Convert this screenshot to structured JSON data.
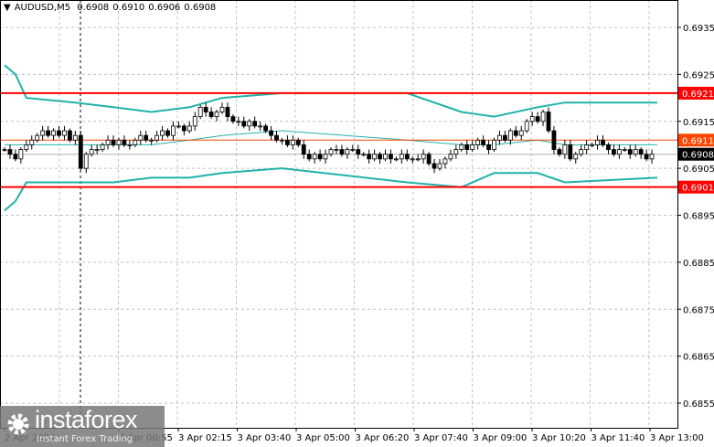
{
  "header": {
    "symbol": "AUDUSD,M5",
    "ohlc": [
      "0.6908",
      "0.6910",
      "0.6906",
      "0.6908"
    ]
  },
  "logo": {
    "brand": "instaforex",
    "tagline": "Instant Forex Trading"
  },
  "colors": {
    "candle": "#000000",
    "bands": "#20b2aa",
    "level": "#ff0000",
    "last_level": "#ff4500",
    "bid": "#000000",
    "grid": "#c0c0c0"
  },
  "chart_data": {
    "type": "candlestick",
    "title": "AUDUSD,M5",
    "ylim": [
      0.6851,
      0.6941
    ],
    "y_ticks": [
      "0.6935",
      "0.6925",
      "0.6915",
      "0.6905",
      "0.6895",
      "0.6885",
      "0.6875",
      "0.6865",
      "0.6855"
    ],
    "x_ticks": [
      "2 Apr 2026",
      "3 Apr 00:55",
      "3 Apr 02:15",
      "3 Apr 03:40",
      "3 Apr 05:00",
      "3 Apr 06:20",
      "3 Apr 07:40",
      "3 Apr 09:00",
      "3 Apr 10:20",
      "3 Apr 11:40",
      "3 Apr 13:00"
    ],
    "grid": true,
    "closes": [
      0.6909,
      0.6908,
      0.6907,
      0.6909,
      0.691,
      0.6911,
      0.6912,
      0.6913,
      0.6912,
      0.6913,
      0.6912,
      0.6913,
      0.6911,
      0.6912,
      0.6905,
      0.6908,
      0.6909,
      0.6909,
      0.691,
      0.6911,
      0.691,
      0.6911,
      0.691,
      0.691,
      0.6911,
      0.6912,
      0.6911,
      0.6911,
      0.6912,
      0.6913,
      0.6912,
      0.6914,
      0.6914,
      0.6913,
      0.6914,
      0.6916,
      0.6918,
      0.6917,
      0.6916,
      0.6917,
      0.6918,
      0.6916,
      0.6915,
      0.6915,
      0.6914,
      0.6915,
      0.6914,
      0.6914,
      0.6913,
      0.6912,
      0.6911,
      0.6911,
      0.691,
      0.6911,
      0.691,
      0.6908,
      0.6907,
      0.6908,
      0.6907,
      0.6908,
      0.6909,
      0.6909,
      0.6908,
      0.6909,
      0.6909,
      0.6908,
      0.6908,
      0.6907,
      0.6908,
      0.6907,
      0.6908,
      0.6907,
      0.6907,
      0.6908,
      0.6907,
      0.6907,
      0.6907,
      0.6908,
      0.6906,
      0.6905,
      0.6906,
      0.6907,
      0.6908,
      0.6909,
      0.691,
      0.6909,
      0.691,
      0.6911,
      0.691,
      0.6909,
      0.6911,
      0.6912,
      0.6911,
      0.6913,
      0.6912,
      0.6913,
      0.6915,
      0.6916,
      0.6915,
      0.6917,
      0.6913,
      0.6909,
      0.6908,
      0.691,
      0.6907,
      0.6908,
      0.6909,
      0.691,
      0.691,
      0.6911,
      0.691,
      0.6909,
      0.6908,
      0.6909,
      0.6909,
      0.6908,
      0.6909,
      0.6908,
      0.6907,
      0.6908
    ],
    "bollinger": {
      "bar_index": [
        0,
        2,
        4,
        13,
        20,
        27,
        34,
        40,
        51,
        74,
        84,
        90,
        98,
        103,
        120
      ],
      "upper": [
        0.6927,
        0.6925,
        0.692,
        0.6919,
        0.6918,
        0.6917,
        0.6918,
        0.692,
        0.6921,
        0.6921,
        0.6917,
        0.6916,
        0.6918,
        0.6919,
        0.6919
      ],
      "middle": [
        0.691,
        0.691,
        0.691,
        0.691,
        0.691,
        0.691,
        0.6911,
        0.6912,
        0.6913,
        0.6911,
        0.691,
        0.691,
        0.6911,
        0.691,
        0.691
      ],
      "lower": [
        0.6896,
        0.6898,
        0.6902,
        0.6902,
        0.6902,
        0.6903,
        0.6903,
        0.6904,
        0.6905,
        0.6902,
        0.6901,
        0.6904,
        0.6904,
        0.6902,
        0.6903
      ]
    },
    "levels": [
      {
        "price": "0.6921",
        "kind": "resistance"
      },
      {
        "price": "0.6911",
        "kind": "last"
      },
      {
        "price": "0.6908",
        "kind": "bid"
      },
      {
        "price": "0.6901",
        "kind": "support"
      }
    ]
  }
}
